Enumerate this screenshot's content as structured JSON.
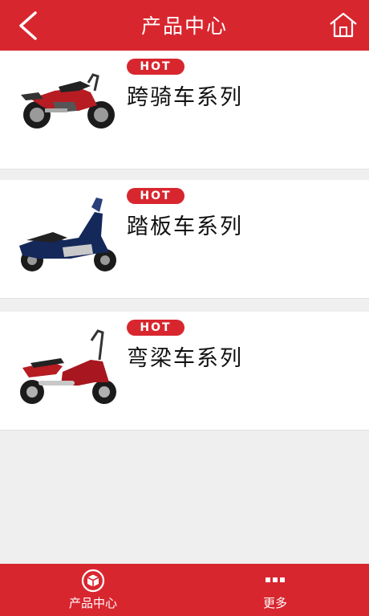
{
  "header": {
    "title": "产品中心",
    "back_icon": "chevron-left-icon",
    "home_icon": "home-icon"
  },
  "products": [
    {
      "badge": "HOT",
      "name": "跨骑车系列",
      "image": "street-motorcycle-red-black"
    },
    {
      "badge": "HOT",
      "name": "踏板车系列",
      "image": "scooter-blue-black"
    },
    {
      "badge": "HOT",
      "name": "弯梁车系列",
      "image": "underbone-motorcycle-red-silver"
    }
  ],
  "footer": {
    "tabs": [
      {
        "label": "产品中心",
        "icon": "box-circle-icon"
      },
      {
        "label": "更多",
        "icon": "more-dots-icon"
      }
    ]
  },
  "colors": {
    "brand": "#d8262f",
    "background": "#efefef",
    "card": "#ffffff"
  }
}
